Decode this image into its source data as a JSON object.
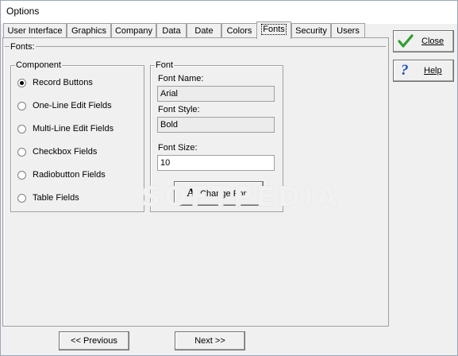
{
  "window": {
    "title": "Options"
  },
  "tabs": [
    {
      "label": "User Interface",
      "active": false
    },
    {
      "label": "Graphics",
      "active": false
    },
    {
      "label": "Company",
      "active": false
    },
    {
      "label": "Data",
      "active": false
    },
    {
      "label": "Date",
      "active": false
    },
    {
      "label": "Colors",
      "active": false
    },
    {
      "label": "Fonts",
      "active": true
    },
    {
      "label": "Security",
      "active": false
    },
    {
      "label": "Users",
      "active": false
    }
  ],
  "fonts_panel": {
    "label": "Fonts:",
    "component_group": {
      "label": "Component",
      "options": [
        {
          "label": "Record Buttons",
          "selected": true
        },
        {
          "label": "One-Line Edit Fields",
          "selected": false
        },
        {
          "label": "Multi-Line Edit Fields",
          "selected": false
        },
        {
          "label": "Checkbox Fields",
          "selected": false
        },
        {
          "label": "Radiobutton Fields",
          "selected": false
        },
        {
          "label": "Table Fields",
          "selected": false
        }
      ]
    },
    "font_group": {
      "label": "Font",
      "font_name_label": "Font Name:",
      "font_name_value": "Arial",
      "font_style_label": "Font Style:",
      "font_style_value": "Bold",
      "font_size_label": "Font Size:",
      "font_size_value": "10",
      "change_font_label": "Change Font",
      "change_font_icon": "A"
    }
  },
  "side_buttons": {
    "close_label": "Close",
    "help_label": "Help"
  },
  "nav": {
    "previous_label": "<< Previous",
    "next_label": "Next >>"
  },
  "watermark": "SOFTPEDIA",
  "colors": {
    "check_green": "#2e9e2e",
    "help_blue": "#1f4fbf"
  }
}
